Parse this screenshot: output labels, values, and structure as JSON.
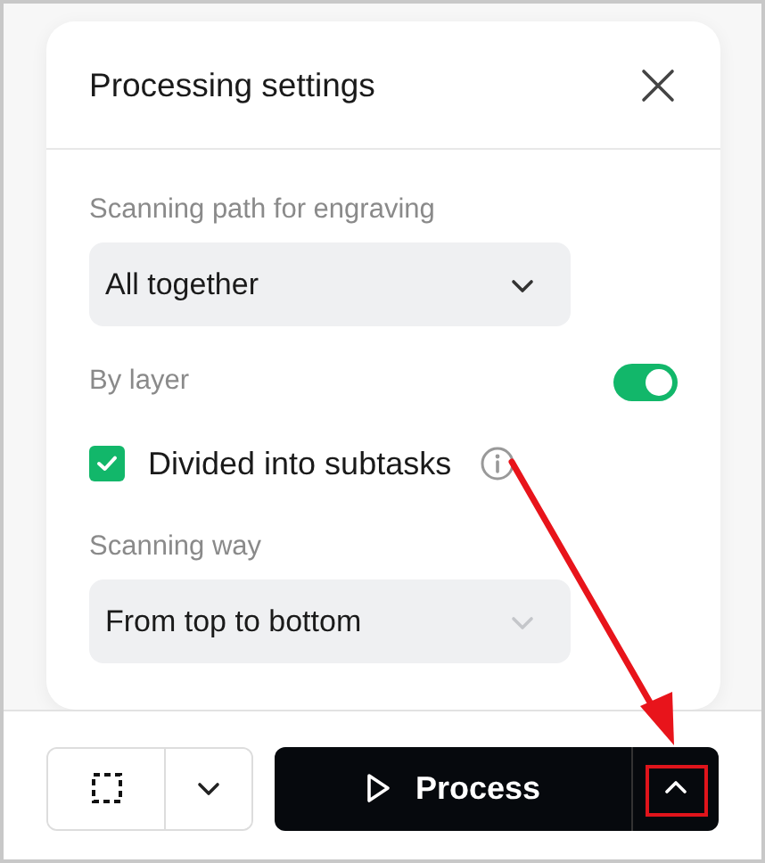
{
  "dialog": {
    "title": "Processing settings"
  },
  "fields": [
    {
      "kind": "select",
      "label": "Scanning path for engraving",
      "value": "All together",
      "disabled": false
    },
    {
      "kind": "toggle",
      "label": "By layer",
      "on": true
    },
    {
      "kind": "checkbox",
      "label": "Divided into subtasks",
      "checked": true
    },
    {
      "kind": "select",
      "label": "Scanning way",
      "value": "From top to bottom",
      "disabled": true
    }
  ],
  "toolbar": {
    "process_label": "Process"
  }
}
